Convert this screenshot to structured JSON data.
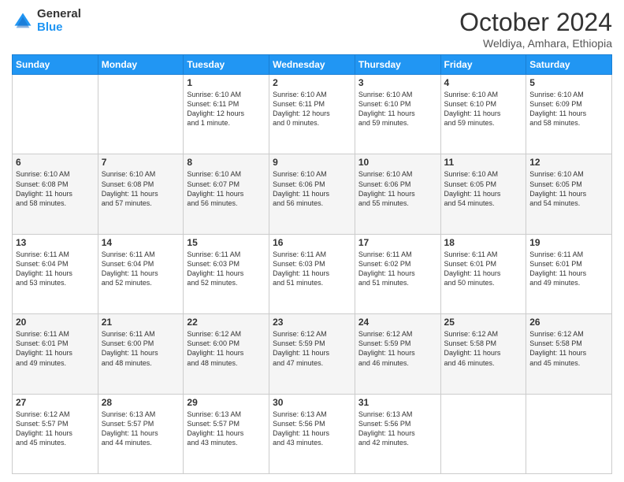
{
  "logo": {
    "general": "General",
    "blue": "Blue"
  },
  "header": {
    "month": "October 2024",
    "location": "Weldiya, Amhara, Ethiopia"
  },
  "weekdays": [
    "Sunday",
    "Monday",
    "Tuesday",
    "Wednesday",
    "Thursday",
    "Friday",
    "Saturday"
  ],
  "weeks": [
    [
      {
        "day": "",
        "content": ""
      },
      {
        "day": "",
        "content": ""
      },
      {
        "day": "1",
        "content": "Sunrise: 6:10 AM\nSunset: 6:11 PM\nDaylight: 12 hours\nand 1 minute."
      },
      {
        "day": "2",
        "content": "Sunrise: 6:10 AM\nSunset: 6:11 PM\nDaylight: 12 hours\nand 0 minutes."
      },
      {
        "day": "3",
        "content": "Sunrise: 6:10 AM\nSunset: 6:10 PM\nDaylight: 11 hours\nand 59 minutes."
      },
      {
        "day": "4",
        "content": "Sunrise: 6:10 AM\nSunset: 6:10 PM\nDaylight: 11 hours\nand 59 minutes."
      },
      {
        "day": "5",
        "content": "Sunrise: 6:10 AM\nSunset: 6:09 PM\nDaylight: 11 hours\nand 58 minutes."
      }
    ],
    [
      {
        "day": "6",
        "content": "Sunrise: 6:10 AM\nSunset: 6:08 PM\nDaylight: 11 hours\nand 58 minutes."
      },
      {
        "day": "7",
        "content": "Sunrise: 6:10 AM\nSunset: 6:08 PM\nDaylight: 11 hours\nand 57 minutes."
      },
      {
        "day": "8",
        "content": "Sunrise: 6:10 AM\nSunset: 6:07 PM\nDaylight: 11 hours\nand 56 minutes."
      },
      {
        "day": "9",
        "content": "Sunrise: 6:10 AM\nSunset: 6:06 PM\nDaylight: 11 hours\nand 56 minutes."
      },
      {
        "day": "10",
        "content": "Sunrise: 6:10 AM\nSunset: 6:06 PM\nDaylight: 11 hours\nand 55 minutes."
      },
      {
        "day": "11",
        "content": "Sunrise: 6:10 AM\nSunset: 6:05 PM\nDaylight: 11 hours\nand 54 minutes."
      },
      {
        "day": "12",
        "content": "Sunrise: 6:10 AM\nSunset: 6:05 PM\nDaylight: 11 hours\nand 54 minutes."
      }
    ],
    [
      {
        "day": "13",
        "content": "Sunrise: 6:11 AM\nSunset: 6:04 PM\nDaylight: 11 hours\nand 53 minutes."
      },
      {
        "day": "14",
        "content": "Sunrise: 6:11 AM\nSunset: 6:04 PM\nDaylight: 11 hours\nand 52 minutes."
      },
      {
        "day": "15",
        "content": "Sunrise: 6:11 AM\nSunset: 6:03 PM\nDaylight: 11 hours\nand 52 minutes."
      },
      {
        "day": "16",
        "content": "Sunrise: 6:11 AM\nSunset: 6:03 PM\nDaylight: 11 hours\nand 51 minutes."
      },
      {
        "day": "17",
        "content": "Sunrise: 6:11 AM\nSunset: 6:02 PM\nDaylight: 11 hours\nand 51 minutes."
      },
      {
        "day": "18",
        "content": "Sunrise: 6:11 AM\nSunset: 6:01 PM\nDaylight: 11 hours\nand 50 minutes."
      },
      {
        "day": "19",
        "content": "Sunrise: 6:11 AM\nSunset: 6:01 PM\nDaylight: 11 hours\nand 49 minutes."
      }
    ],
    [
      {
        "day": "20",
        "content": "Sunrise: 6:11 AM\nSunset: 6:01 PM\nDaylight: 11 hours\nand 49 minutes."
      },
      {
        "day": "21",
        "content": "Sunrise: 6:11 AM\nSunset: 6:00 PM\nDaylight: 11 hours\nand 48 minutes."
      },
      {
        "day": "22",
        "content": "Sunrise: 6:12 AM\nSunset: 6:00 PM\nDaylight: 11 hours\nand 48 minutes."
      },
      {
        "day": "23",
        "content": "Sunrise: 6:12 AM\nSunset: 5:59 PM\nDaylight: 11 hours\nand 47 minutes."
      },
      {
        "day": "24",
        "content": "Sunrise: 6:12 AM\nSunset: 5:59 PM\nDaylight: 11 hours\nand 46 minutes."
      },
      {
        "day": "25",
        "content": "Sunrise: 6:12 AM\nSunset: 5:58 PM\nDaylight: 11 hours\nand 46 minutes."
      },
      {
        "day": "26",
        "content": "Sunrise: 6:12 AM\nSunset: 5:58 PM\nDaylight: 11 hours\nand 45 minutes."
      }
    ],
    [
      {
        "day": "27",
        "content": "Sunrise: 6:12 AM\nSunset: 5:57 PM\nDaylight: 11 hours\nand 45 minutes."
      },
      {
        "day": "28",
        "content": "Sunrise: 6:13 AM\nSunset: 5:57 PM\nDaylight: 11 hours\nand 44 minutes."
      },
      {
        "day": "29",
        "content": "Sunrise: 6:13 AM\nSunset: 5:57 PM\nDaylight: 11 hours\nand 43 minutes."
      },
      {
        "day": "30",
        "content": "Sunrise: 6:13 AM\nSunset: 5:56 PM\nDaylight: 11 hours\nand 43 minutes."
      },
      {
        "day": "31",
        "content": "Sunrise: 6:13 AM\nSunset: 5:56 PM\nDaylight: 11 hours\nand 42 minutes."
      },
      {
        "day": "",
        "content": ""
      },
      {
        "day": "",
        "content": ""
      }
    ]
  ]
}
